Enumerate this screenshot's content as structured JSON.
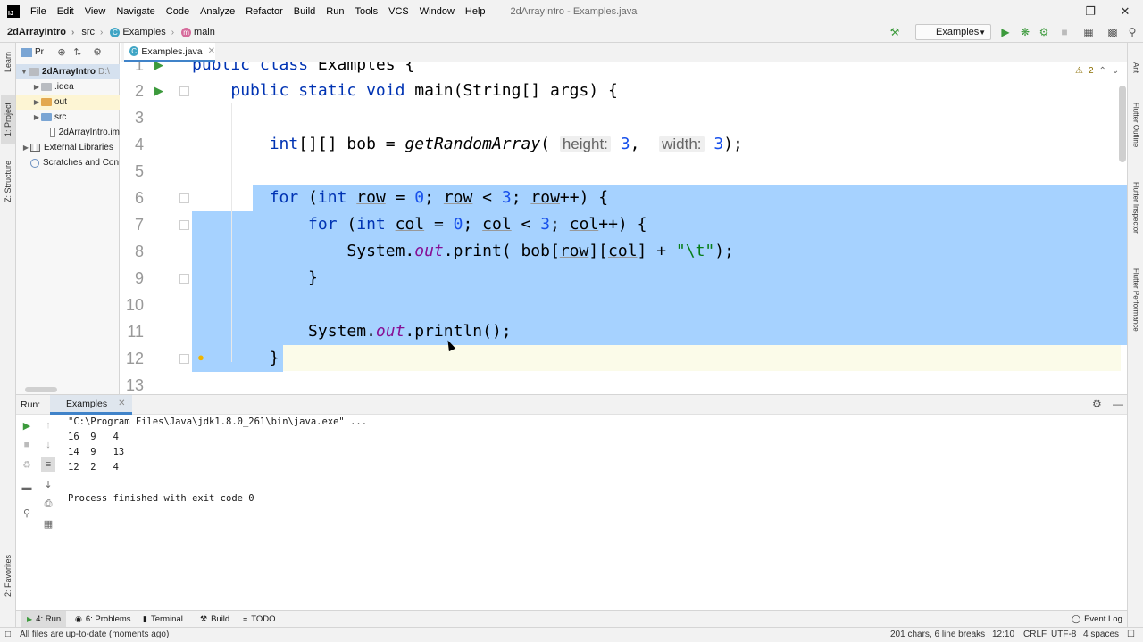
{
  "menubar": {
    "items": [
      "File",
      "Edit",
      "View",
      "Navigate",
      "Code",
      "Analyze",
      "Refactor",
      "Build",
      "Run",
      "Tools",
      "VCS",
      "Window",
      "Help"
    ],
    "window_title": "2dArrayIntro - Examples.java"
  },
  "navbar": {
    "crumbs": [
      "2dArrayIntro",
      "src",
      "Examples",
      "main"
    ],
    "run_config": "Examples"
  },
  "left_stripe": {
    "tabs": [
      "1: Project",
      "Learn",
      "Z: Structure",
      "2: Favorites"
    ]
  },
  "right_stripe": {
    "tabs": [
      "Ant",
      "Flutter Outline",
      "Flutter Inspector",
      "Flutter Performance"
    ]
  },
  "project": {
    "header_label": "Pr",
    "tree": [
      {
        "label": "2dArrayIntro",
        "suffix": "D:\\"
      },
      {
        "label": ".idea"
      },
      {
        "label": "out"
      },
      {
        "label": "src"
      },
      {
        "label": "2dArrayIntro.im"
      },
      {
        "label": "External Libraries"
      },
      {
        "label": "Scratches and Con"
      }
    ]
  },
  "editor": {
    "tab_label": "Examples.java",
    "warning_count": "2",
    "line_numbers": [
      "1",
      "2",
      "3",
      "4",
      "5",
      "6",
      "7",
      "8",
      "9",
      "10",
      "11",
      "12",
      "13"
    ],
    "hints": {
      "height": "height:",
      "width": "width:"
    }
  },
  "run_panel": {
    "title": "Run:",
    "tab_label": "Examples",
    "console": [
      "\"C:\\Program Files\\Java\\jdk1.8.0_261\\bin\\java.exe\" ...",
      "16  9   4",
      "14  9   13",
      "12  2   4",
      "",
      "Process finished with exit code 0"
    ]
  },
  "bottom_tabs": [
    "4: Run",
    "6: Problems",
    "Terminal",
    "Build",
    "TODO",
    "Event Log"
  ],
  "statusbar": {
    "message": "All files are up-to-date (moments ago)",
    "selection": "201 chars, 6 line breaks",
    "position": "12:10",
    "line_sep": "CRLF",
    "encoding": "UTF-8",
    "indent": "4 spaces"
  },
  "colors": {
    "selection": "#a6d2ff",
    "keyword": "#0033b3",
    "number": "#1750eb",
    "string": "#067d17",
    "field": "#871094",
    "run_icon": "#3c9a3c",
    "accent": "#4083c9"
  }
}
